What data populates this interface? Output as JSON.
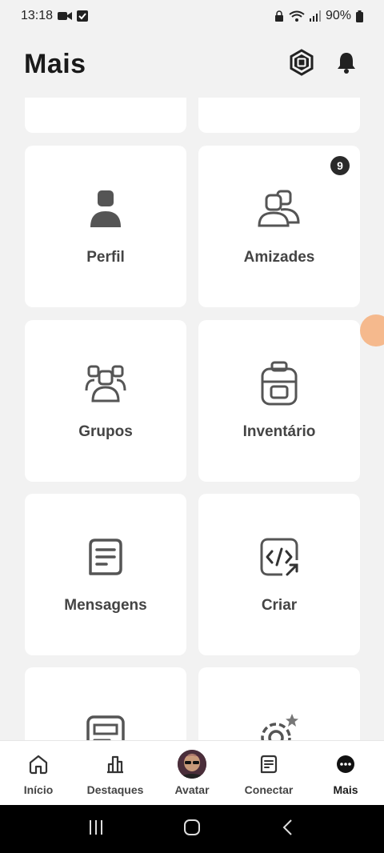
{
  "status_bar": {
    "time": "13:18",
    "battery": "90%"
  },
  "header": {
    "title": "Mais",
    "robux_icon": "robux-icon",
    "bell_icon": "bell-icon"
  },
  "cards": [
    {
      "id": "perfil",
      "label": "Perfil",
      "icon": "person-icon"
    },
    {
      "id": "amizades",
      "label": "Amizades",
      "icon": "friends-icon",
      "badge": "9"
    },
    {
      "id": "grupos",
      "label": "Grupos",
      "icon": "groups-icon"
    },
    {
      "id": "inventario",
      "label": "Inventário",
      "icon": "backpack-icon"
    },
    {
      "id": "mensagens",
      "label": "Mensagens",
      "icon": "message-icon"
    },
    {
      "id": "criar",
      "label": "Criar",
      "icon": "code-icon"
    },
    {
      "id": "blog",
      "label": "",
      "icon": "blog-icon"
    },
    {
      "id": "configuracoes",
      "label": "",
      "icon": "settings-icon"
    }
  ],
  "bottom_nav": {
    "items": [
      {
        "label": "Início",
        "icon": "home-icon"
      },
      {
        "label": "Destaques",
        "icon": "chart-icon"
      },
      {
        "label": "Avatar",
        "icon": "avatar-icon"
      },
      {
        "label": "Conectar",
        "icon": "chat-icon"
      },
      {
        "label": "Mais",
        "icon": "more-icon",
        "active": true
      }
    ]
  },
  "colors": {
    "background": "#f2f2f2",
    "card": "#ffffff",
    "icon": "#555555",
    "bubble": "#f5b98d"
  }
}
